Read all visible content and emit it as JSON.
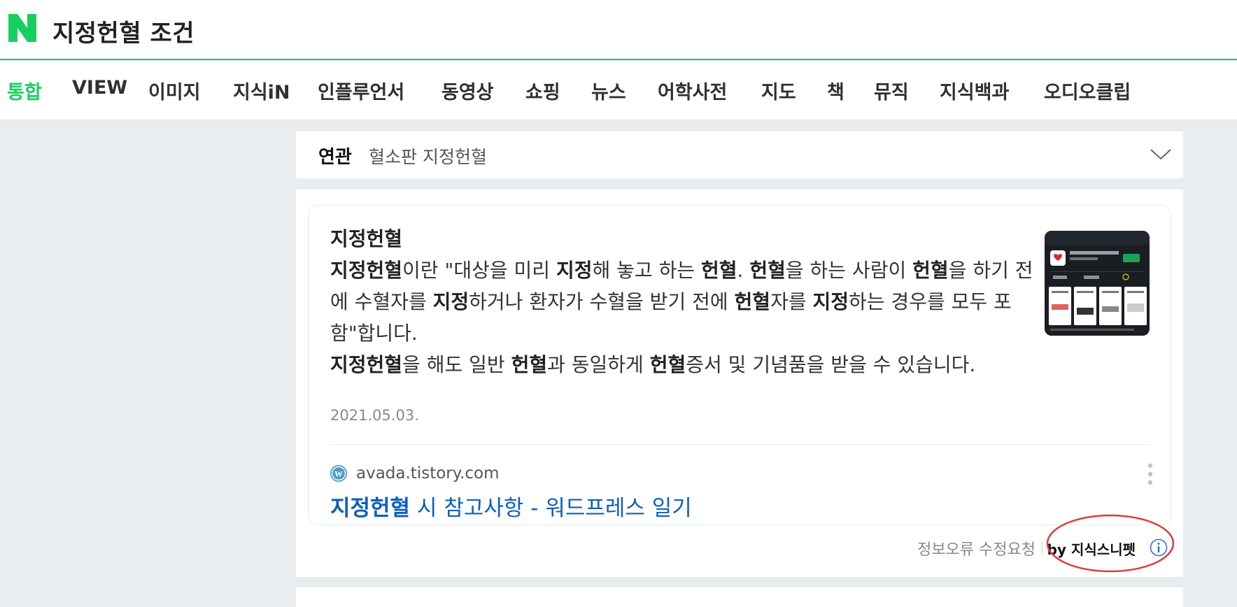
{
  "colors": {
    "brand_green": "#19ce60",
    "link_blue": "#0b5fc1",
    "annotation_red": "#e0393e"
  },
  "header": {
    "logo_icon": "naver-n-logo-icon",
    "search_query": "지정헌혈 조건"
  },
  "tabs": [
    {
      "label": "통합",
      "active": true
    },
    {
      "label": "VIEW"
    },
    {
      "label": "이미지"
    },
    {
      "label": "지식iN"
    },
    {
      "label": "인플루언서"
    },
    {
      "label": "동영상"
    },
    {
      "label": "쇼핑"
    },
    {
      "label": "뉴스"
    },
    {
      "label": "어학사전"
    },
    {
      "label": "지도"
    },
    {
      "label": "책"
    },
    {
      "label": "뮤직"
    },
    {
      "label": "지식백과"
    },
    {
      "label": "오디오클립"
    }
  ],
  "related": {
    "label": "연관",
    "term": "혈소판 지정헌혈",
    "toggle_icon": "chevron-down-icon"
  },
  "snippet": {
    "title": "지정헌혈",
    "body": [
      {
        "text": "지정헌혈",
        "bold": true
      },
      {
        "text": "이란 \"대상을 미리 "
      },
      {
        "text": "지정",
        "bold": true
      },
      {
        "text": "해 놓고 하는 "
      },
      {
        "text": "헌혈",
        "bold": true
      },
      {
        "text": ". "
      },
      {
        "text": "헌혈",
        "bold": true
      },
      {
        "text": "을 하는 사람이 "
      },
      {
        "text": "헌혈",
        "bold": true
      },
      {
        "text": "을 하기 전에 수혈자를 "
      },
      {
        "text": "지정",
        "bold": true
      },
      {
        "text": "하거나 환자가 수혈을 받기 전에 "
      },
      {
        "text": "헌혈",
        "bold": true
      },
      {
        "text": "자를 "
      },
      {
        "text": "지정",
        "bold": true
      },
      {
        "text": "하는 경우를 모두 포함\"합니다."
      },
      {
        "break": true
      },
      {
        "text": "지정헌혈",
        "bold": true
      },
      {
        "text": "을 해도 일반 "
      },
      {
        "text": "헌혈",
        "bold": true
      },
      {
        "text": "과 동일하게 "
      },
      {
        "text": "헌혈",
        "bold": true
      },
      {
        "text": "증서 및 기념품을 받을 수 있습니다."
      }
    ],
    "date": "2021.05.03.",
    "site_icon": "wordpress-icon",
    "site_url": "avada.tistory.com",
    "link_keyword": "지정헌혈",
    "link_rest": " 시 참고사항 - 워드프레스 일기",
    "more_icon": "more-options-icon"
  },
  "footer": {
    "report_label": "정보오류 수정요청",
    "by_label": "by 지식스니펫",
    "info_icon": "info-icon"
  }
}
